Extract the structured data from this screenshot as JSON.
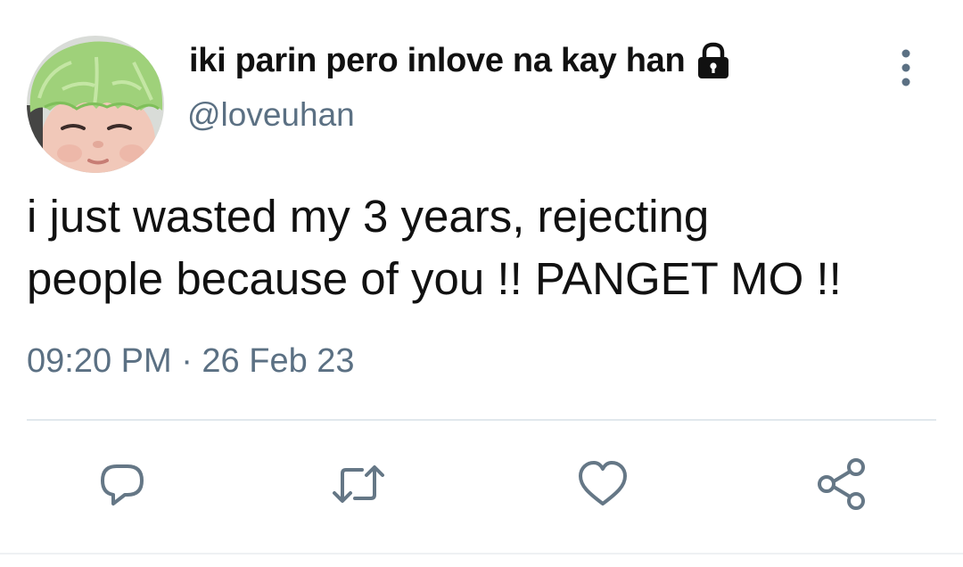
{
  "user": {
    "display_name": "iki parin pero inlove na kay han",
    "handle": "@loveuhan",
    "protected_icon": "lock-icon",
    "avatar": "baby-with-lettuce-avatar"
  },
  "tweet": {
    "text": "i just wasted my 3 years, rejecting\npeople because of you !! PANGET MO !!",
    "timestamp": "09:20 PM · 26 Feb 23"
  },
  "actions": [
    {
      "icon": "reply-icon"
    },
    {
      "icon": "retweet-icon"
    },
    {
      "icon": "like-icon"
    },
    {
      "icon": "share-icon"
    }
  ],
  "colors": {
    "text": "#111111",
    "secondary": "#5b7083",
    "action_icon": "#657786",
    "divider": "#e1e8ed"
  }
}
